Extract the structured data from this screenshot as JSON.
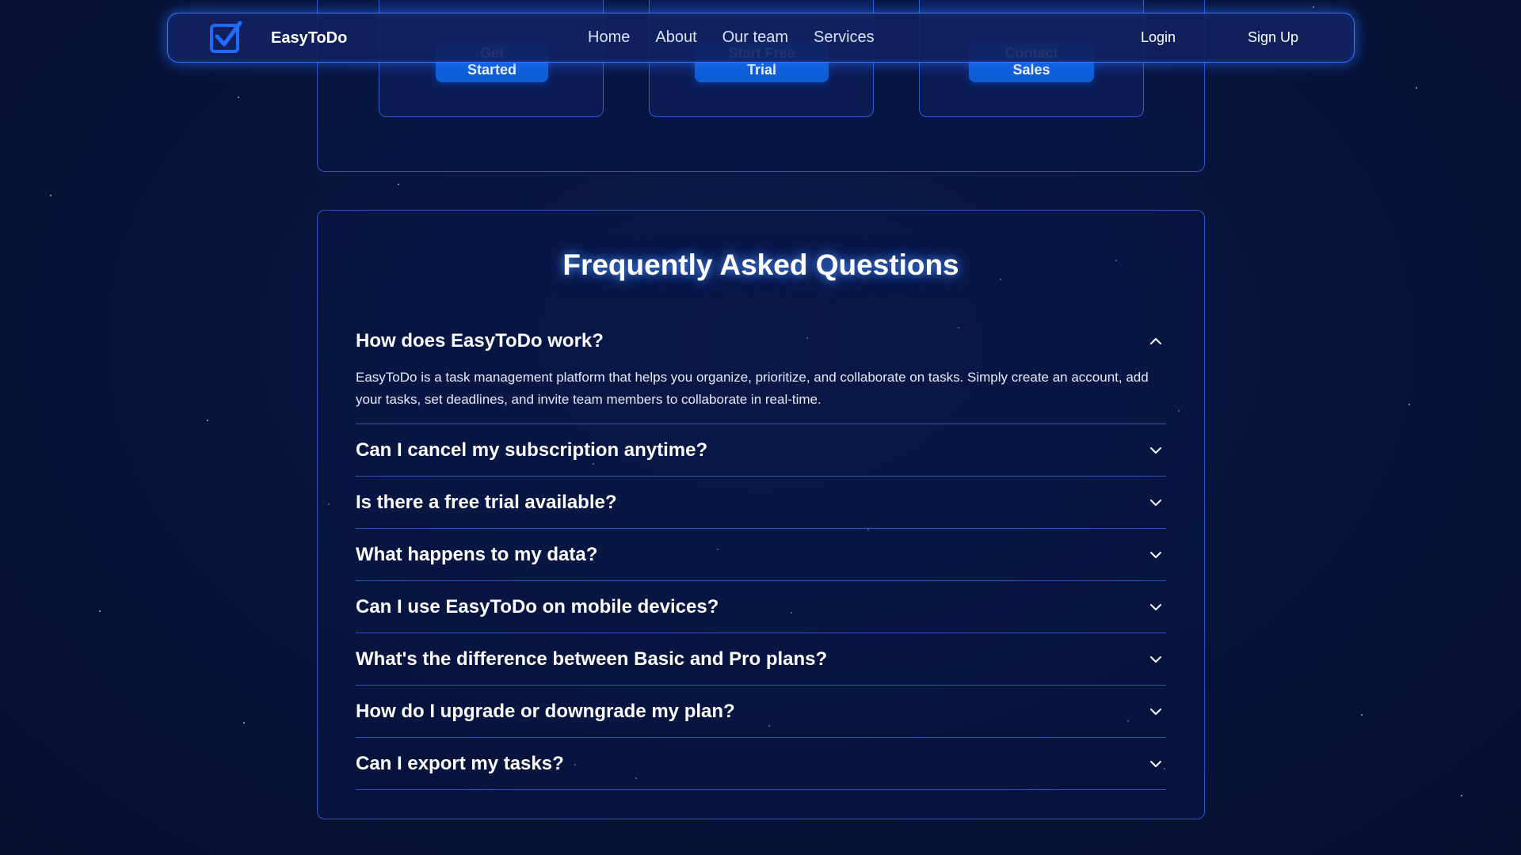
{
  "brand": {
    "name": "EasyToDo",
    "accent": "#3d74ff",
    "button_color": "#0f5ed8"
  },
  "nav": {
    "links": [
      "Home",
      "About",
      "Our team",
      "Services"
    ],
    "login": "Login",
    "signup": "Sign Up"
  },
  "pricing": {
    "buttons": [
      "Get Started",
      "Start Free Trial",
      "Contact Sales"
    ]
  },
  "faq": {
    "title": "Frequently Asked Questions",
    "items": [
      {
        "question": "How does EasyToDo work?",
        "answer": "EasyToDo is a task management platform that helps you organize, prioritize, and collaborate on tasks. Simply create an account, add your tasks, set deadlines, and invite team members to collaborate in real-time.",
        "expanded": true
      },
      {
        "question": "Can I cancel my subscription anytime?",
        "expanded": false
      },
      {
        "question": "Is there a free trial available?",
        "expanded": false
      },
      {
        "question": "What happens to my data?",
        "expanded": false
      },
      {
        "question": "Can I use EasyToDo on mobile devices?",
        "expanded": false
      },
      {
        "question": "What's the difference between Basic and Pro plans?",
        "expanded": false
      },
      {
        "question": "How do I upgrade or downgrade my plan?",
        "expanded": false
      },
      {
        "question": "Can I export my tasks?",
        "expanded": false
      }
    ],
    "icons": {
      "expanded": "chevron-up-icon",
      "collapsed": "chevron-down-icon"
    }
  }
}
